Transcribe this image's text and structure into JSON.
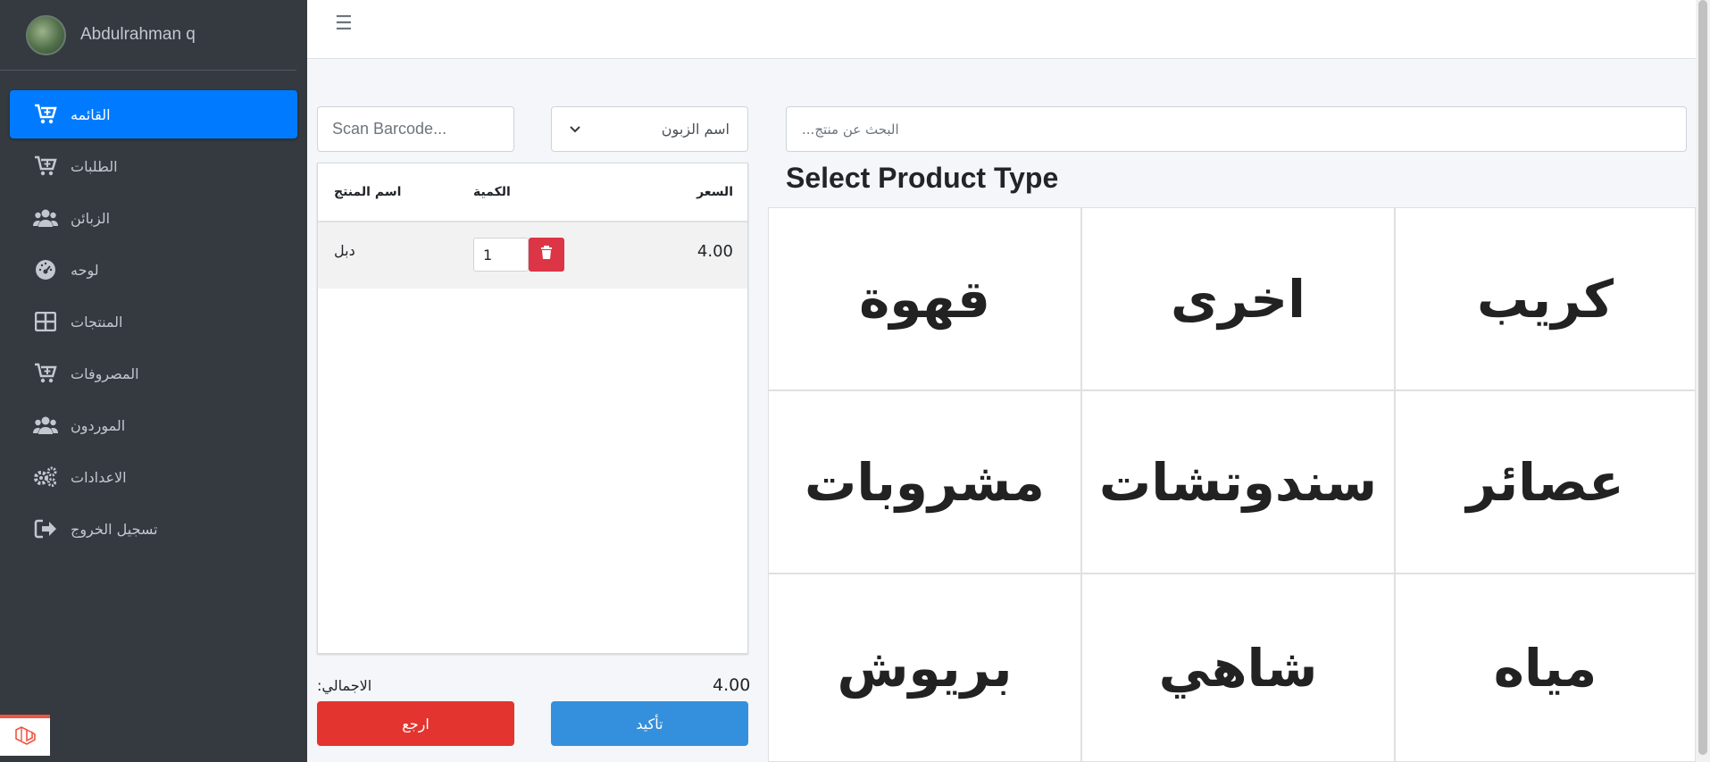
{
  "user": {
    "name": "Abdulrahman q"
  },
  "sidebar": {
    "items": [
      {
        "label": "القائمه",
        "icon": "cart-plus-icon",
        "active": true
      },
      {
        "label": "الطلبات",
        "icon": "cart-plus-icon"
      },
      {
        "label": "الزبائن",
        "icon": "users-icon"
      },
      {
        "label": "لوحه",
        "icon": "dashboard-gauge-icon"
      },
      {
        "label": "المنتجات",
        "icon": "grid-icon"
      },
      {
        "label": "المصروفات",
        "icon": "cart-plus-icon"
      },
      {
        "label": "الموردون",
        "icon": "users-icon"
      },
      {
        "label": "الاعدادات",
        "icon": "gears-icon"
      },
      {
        "label": "تسجيل الخروج",
        "icon": "sign-out-icon"
      }
    ]
  },
  "cart": {
    "barcode_placeholder": "Scan Barcode...",
    "customer_select": "اسم الزبون",
    "headers": {
      "product": "اسم المنتج",
      "quantity": "الكمية",
      "price": "السعر"
    },
    "rows": [
      {
        "product": "دبل",
        "quantity": "1",
        "price": "4.00"
      }
    ],
    "total_label": ":الاجمالي",
    "total_value": "4.00",
    "back_label": "ارجع",
    "confirm_label": "تأكيد"
  },
  "products": {
    "search_placeholder": "...البحث عن منتج",
    "title": "Select Product Type",
    "types": [
      "قهوة",
      "اخرى",
      "كريب",
      "مشروبات",
      "سندوتشات",
      "عصائر",
      "بريوش",
      "شاهي",
      "مياه"
    ]
  },
  "colors": {
    "sidebar_bg": "#343a40",
    "active_blue": "#007bff",
    "danger": "#e3342f",
    "primary": "#3490dc"
  }
}
